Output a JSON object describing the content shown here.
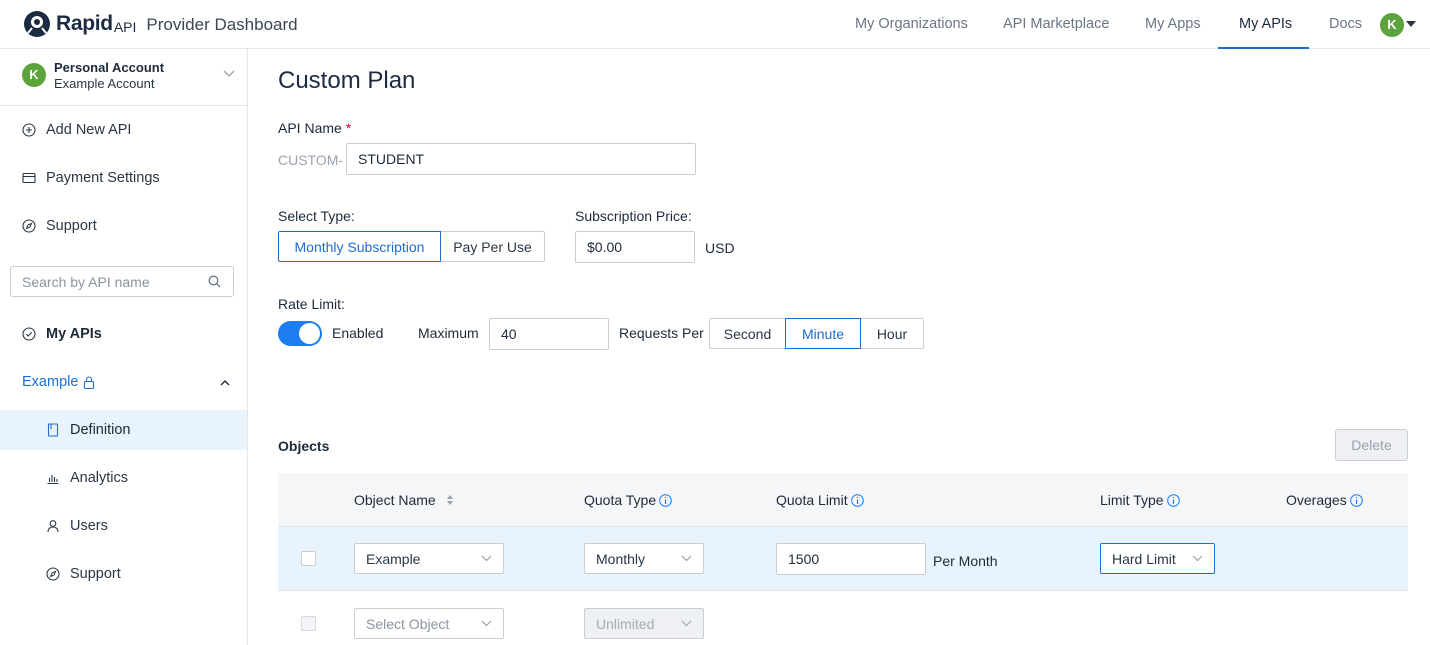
{
  "header": {
    "brand_main": "Rapid",
    "brand_api": "API",
    "brand_subtitle": "Provider Dashboard",
    "nav": [
      "My Organizations",
      "API Marketplace",
      "My Apps",
      "My APIs",
      "Docs"
    ],
    "active_nav": "My APIs",
    "avatar_initial": "K"
  },
  "sidebar": {
    "account_name": "Personal Account",
    "account_org": "Example Account",
    "avatar_initial": "K",
    "add_api": "Add New API",
    "payment": "Payment Settings",
    "support": "Support",
    "search_placeholder": "Search by API name",
    "my_apis": "My APIs",
    "api_name": "Example",
    "sub_items": [
      "Definition",
      "Analytics",
      "Users",
      "Support"
    ],
    "active_sub_item": "Definition"
  },
  "main": {
    "title": "Custom Plan",
    "api_name_label": "API Name",
    "required_mark": "*",
    "prefix": "CUSTOM-",
    "api_name_value": "STUDENT",
    "select_type_label": "Select Type:",
    "type_options": [
      "Monthly Subscription",
      "Pay Per Use"
    ],
    "type_selected": "Monthly Subscription",
    "price_label": "Subscription Price:",
    "price_value": "$0.00",
    "currency": "USD",
    "rate_limit_label": "Rate Limit:",
    "rate_limit_enabled": true,
    "enabled_label": "Enabled",
    "maximum_label": "Maximum",
    "maximum_value": "40",
    "requests_per_label": "Requests Per",
    "period_options": [
      "Second",
      "Minute",
      "Hour"
    ],
    "period_selected": "Minute",
    "objects_label": "Objects",
    "delete_label": "Delete"
  },
  "table": {
    "headers": [
      "Object Name",
      "Quota Type",
      "Quota Limit",
      "Limit Type",
      "Overages"
    ],
    "rows": [
      {
        "object": "Example",
        "quota_type": "Monthly",
        "quota_limit": "1500",
        "per": "Per Month",
        "limit_type": "Hard Limit"
      },
      {
        "object": "Select Object",
        "quota_type": "Unlimited"
      }
    ]
  },
  "colors": {
    "accent": "#1c6fd1",
    "selected_row": "#e9f3fb",
    "avatar": "#5ca33b"
  }
}
